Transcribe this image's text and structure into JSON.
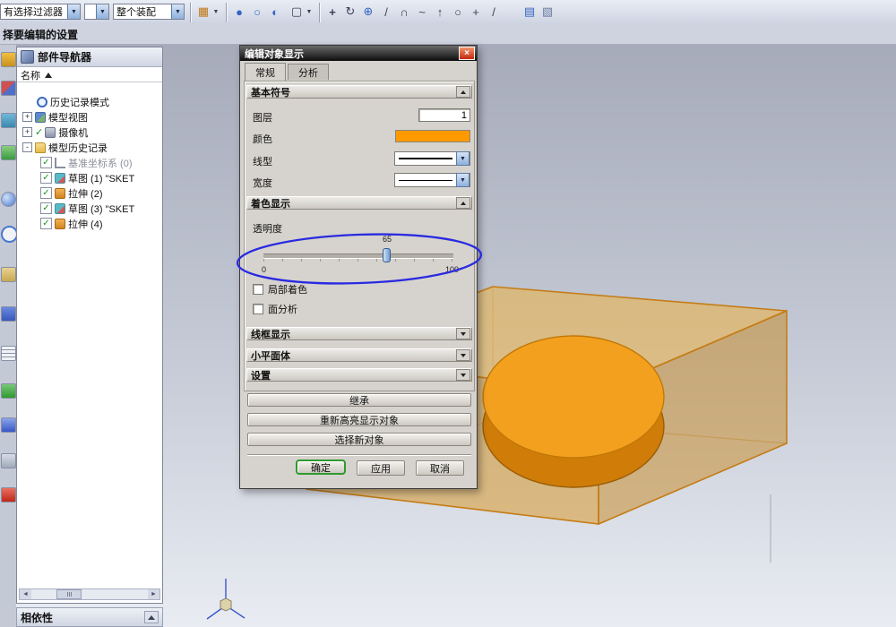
{
  "toolbar": {
    "selection_filter": "有选择过滤器",
    "assembly_scope": "整个装配"
  },
  "prompt": "择要编辑的设置",
  "icons": {
    "close": "×",
    "dropdown": "▼",
    "sort": "▲",
    "check": "✓",
    "scroll_left": "◄",
    "scroll_right": "►",
    "palette": "▦",
    "shaded": "●",
    "wireframe": "○",
    "half": "◐",
    "selbox": "▢",
    "pan": "+",
    "rotate": "↻",
    "zoom": "⊕",
    "line": "/",
    "arc": "∩",
    "spline": "~",
    "arrow": "↑",
    "circle": "○",
    "point": "+",
    "slash": "/",
    "doc": "▤",
    "cube": "▧"
  },
  "navigator": {
    "title": "部件导航器",
    "name_header": "名称",
    "items": [
      {
        "label": "历史记录模式"
      },
      {
        "label": "模型视图",
        "expand": "+"
      },
      {
        "label": "摄像机",
        "expand": "+"
      },
      {
        "label": "模型历史记录",
        "expand": "-"
      },
      {
        "label": "基准坐标系 (0)"
      },
      {
        "label": "草图 (1) \"SKET"
      },
      {
        "label": "拉伸 (2)"
      },
      {
        "label": "草图 (3) \"SKET"
      },
      {
        "label": "拉伸 (4)"
      }
    ],
    "footer": "相依性"
  },
  "dialog": {
    "title": "编辑对象显示",
    "tab_general": "常规",
    "tab_analysis": "分析",
    "section_basic": "基本符号",
    "layer_label": "图层",
    "layer_value": "1",
    "color_label": "颜色",
    "linetype_label": "线型",
    "width_label": "宽度",
    "section_shaded": "着色显示",
    "transparency_label": "透明度",
    "transparency_value": "65",
    "scale_min": "0",
    "scale_max": "100",
    "partial_shading_label": "局部着色",
    "face_analysis_label": "面分析",
    "section_wireframe": "线框显示",
    "section_facet": "小平面体",
    "section_settings": "设置",
    "inherit_button": "继承",
    "rehighlight_button": "重新高亮显示对象",
    "select_new_button": "选择新对象",
    "ok_button": "确定",
    "apply_button": "应用",
    "cancel_button": "取消"
  },
  "colors": {
    "object_color": "#ff9900",
    "annotation_blue": "#2a2ae0",
    "ok_green": "#2f9a2f"
  }
}
